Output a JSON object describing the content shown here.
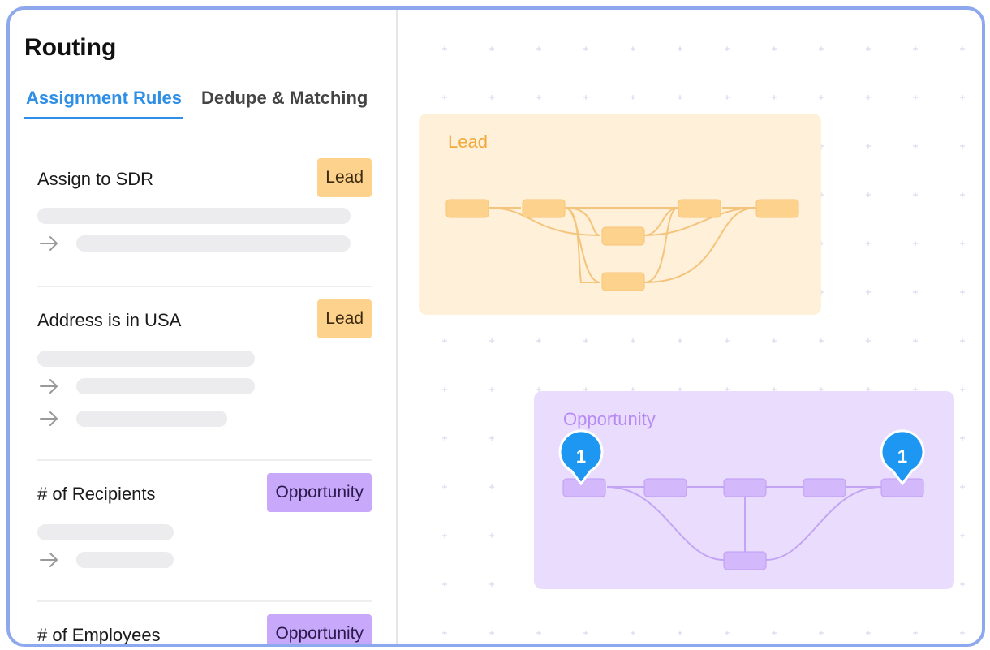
{
  "sidebar": {
    "title": "Routing",
    "tabs": [
      {
        "label": "Assignment Rules",
        "active": true
      },
      {
        "label": "Dedupe & Matching",
        "active": false
      }
    ],
    "rules": [
      {
        "name": "Assign to SDR",
        "badge": "Lead",
        "badge_type": "lead"
      },
      {
        "name": "Address is in USA",
        "badge": "Lead",
        "badge_type": "lead"
      },
      {
        "name": "# of Recipients",
        "badge": "Opportunity",
        "badge_type": "opportunity"
      },
      {
        "name": "# of Employees",
        "badge": "Opportunity",
        "badge_type": "opportunity"
      }
    ]
  },
  "canvas": {
    "lead_panel": {
      "label": "Lead"
    },
    "opportunity_panel": {
      "label": "Opportunity",
      "marker_left": "1",
      "marker_right": "1"
    }
  },
  "colors": {
    "accent": "#2f8fe6",
    "lead": "#fcd28d",
    "opportunity": "#c8a8fb",
    "frame": "#8ea8ee",
    "marker": "#1e97f3"
  }
}
